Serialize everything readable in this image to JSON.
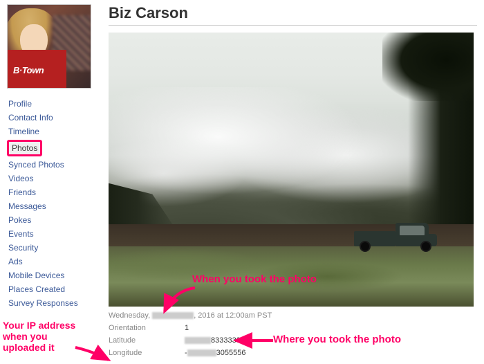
{
  "page": {
    "title": "Biz Carson"
  },
  "avatar": {
    "shirt_text": "B·Town"
  },
  "sidebar": {
    "items": [
      {
        "label": "Profile",
        "active": false
      },
      {
        "label": "Contact Info",
        "active": false
      },
      {
        "label": "Timeline",
        "active": false
      },
      {
        "label": "Photos",
        "active": true
      },
      {
        "label": "Synced Photos",
        "active": false
      },
      {
        "label": "Videos",
        "active": false
      },
      {
        "label": "Friends",
        "active": false
      },
      {
        "label": "Messages",
        "active": false
      },
      {
        "label": "Pokes",
        "active": false
      },
      {
        "label": "Events",
        "active": false
      },
      {
        "label": "Security",
        "active": false
      },
      {
        "label": "Ads",
        "active": false
      },
      {
        "label": "Mobile Devices",
        "active": false
      },
      {
        "label": "Places Created",
        "active": false
      },
      {
        "label": "Survey Responses",
        "active": false
      }
    ]
  },
  "photo": {
    "taken_prefix": "Wednesday, ",
    "taken_suffix": ", 2016 at 12:00am PST",
    "orientation_label": "Orientation",
    "orientation_value": "1",
    "latitude_label": "Latitude",
    "latitude_suffix": "833333333",
    "longitude_label": "Longitude",
    "longitude_prefix": "-",
    "longitude_suffix": "3055556"
  },
  "annotations": {
    "when": "When you took the photo",
    "where": "Where you took the photo",
    "ip": "Your IP address when you uploaded it"
  }
}
